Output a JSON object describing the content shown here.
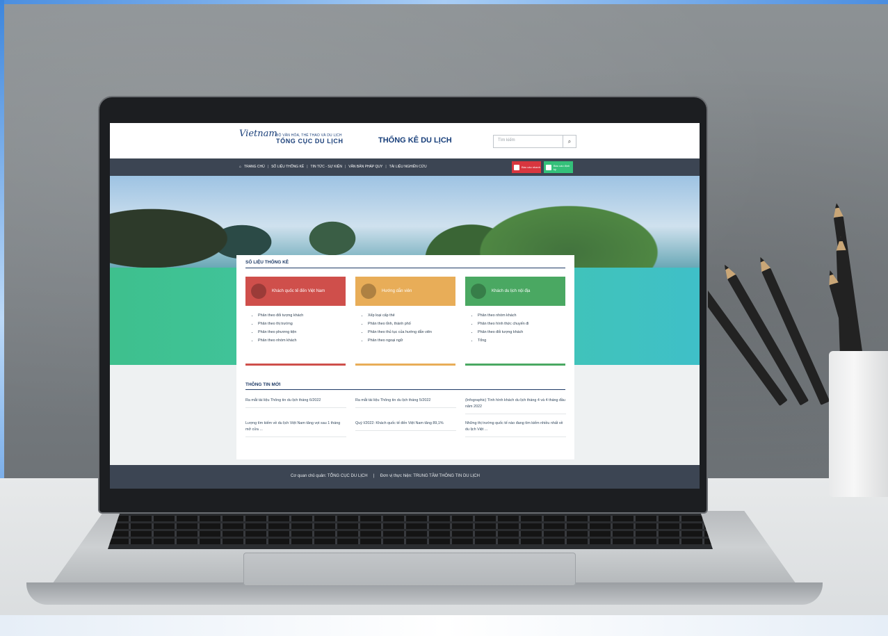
{
  "header": {
    "logo_text": "Vietnam",
    "org_line1": "BỘ VĂN HÓA, THỂ THAO VÀ DU LỊCH",
    "org_line2": "TỔNG CỤC DU LỊCH",
    "site_title": "THỐNG KÊ DU LỊCH",
    "search_placeholder": "Tìm kiếm",
    "search_icon": "search-icon"
  },
  "nav": {
    "items": [
      "TRANG CHỦ",
      "SỐ LIỆU THỐNG KÊ",
      "TIN TỨC - SỰ KIỆN",
      "VĂN BẢN PHÁP QUY",
      "TÀI LIỆU NGHIÊN CỨU"
    ],
    "quick_buttons": [
      {
        "label": "Báo cáo nhanh",
        "color": "#d8363f"
      },
      {
        "label": "Báo cáo định kỳ",
        "color": "#34c07a"
      }
    ]
  },
  "stats": {
    "title": "SỐ LIỆU THỐNG KÊ",
    "cards": [
      {
        "title": "Khách quốc tế đến Việt Nam",
        "color": "#cf4f4b",
        "items": [
          "Phân theo đối tượng khách",
          "Phân theo thị trường",
          "Phân theo phương tiện",
          "Phân theo nhóm khách"
        ]
      },
      {
        "title": "Hướng dẫn viên",
        "color": "#e8ad58",
        "items": [
          "Xếp loại cấp thẻ",
          "Phân theo tỉnh, thành phố",
          "Phân theo thủ tục của hướng dẫn viên",
          "Phân theo ngoại ngữ"
        ]
      },
      {
        "title": "Khách du lịch nội địa",
        "color": "#4aa862",
        "items": [
          "Phân theo nhóm khách",
          "Phân theo hình thức chuyến đi",
          "Phân theo đối tượng khách",
          "Tổng"
        ]
      }
    ]
  },
  "news": {
    "title": "THÔNG TIN MỚI",
    "items": [
      "Ra mắt tài liệu Thông tin du lịch tháng 6/2022",
      "Ra mắt tài liệu Thông tin du lịch tháng 5/2022",
      "(Infographic) Tình hình khách du lịch tháng 4 và 4 tháng đầu năm 2022",
      "Lượng tìm kiếm về du lịch Việt Nam tăng vọt sau 1 tháng mở cửa ...",
      "Quý I/2022: Khách quốc tế đến Việt Nam tăng 89,1%",
      "Những thị trường quốc tế nào đang tìm kiếm nhiều nhất về du lịch Việt ..."
    ]
  },
  "footer": {
    "text": "Cơ quan chủ quản: TỔNG CỤC DU LỊCH     |     Đơn vị thực hiện: TRUNG TÂM THÔNG TIN DU LỊCH"
  }
}
